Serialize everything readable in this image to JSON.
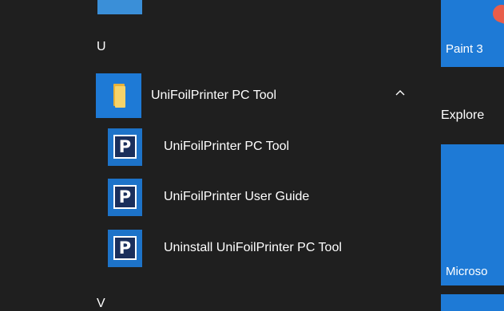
{
  "start_menu": {
    "groups": [
      {
        "letter": "U"
      },
      {
        "letter": "V"
      }
    ],
    "folder": {
      "label": "UniFoilPrinter PC Tool",
      "icon": "folder-icon",
      "expanded_indicator": "chevron-up-icon"
    },
    "items": [
      {
        "label": "UniFoilPrinter PC Tool",
        "icon": "unifoilprinter-p-icon"
      },
      {
        "label": "UniFoilPrinter User Guide",
        "icon": "unifoilprinter-p-icon"
      },
      {
        "label": "Uninstall UniFoilPrinter PC Tool",
        "icon": "unifoilprinter-p-icon"
      }
    ]
  },
  "tiles": {
    "paint_label": "Paint 3",
    "section_label": "Explore",
    "microsoft_label": "Microso"
  },
  "colors": {
    "background": "#1f1f1f",
    "accent": "#1e7ad6",
    "folder_yellow": "#f6d36a",
    "app_logo_navy": "#1a2f5c"
  }
}
